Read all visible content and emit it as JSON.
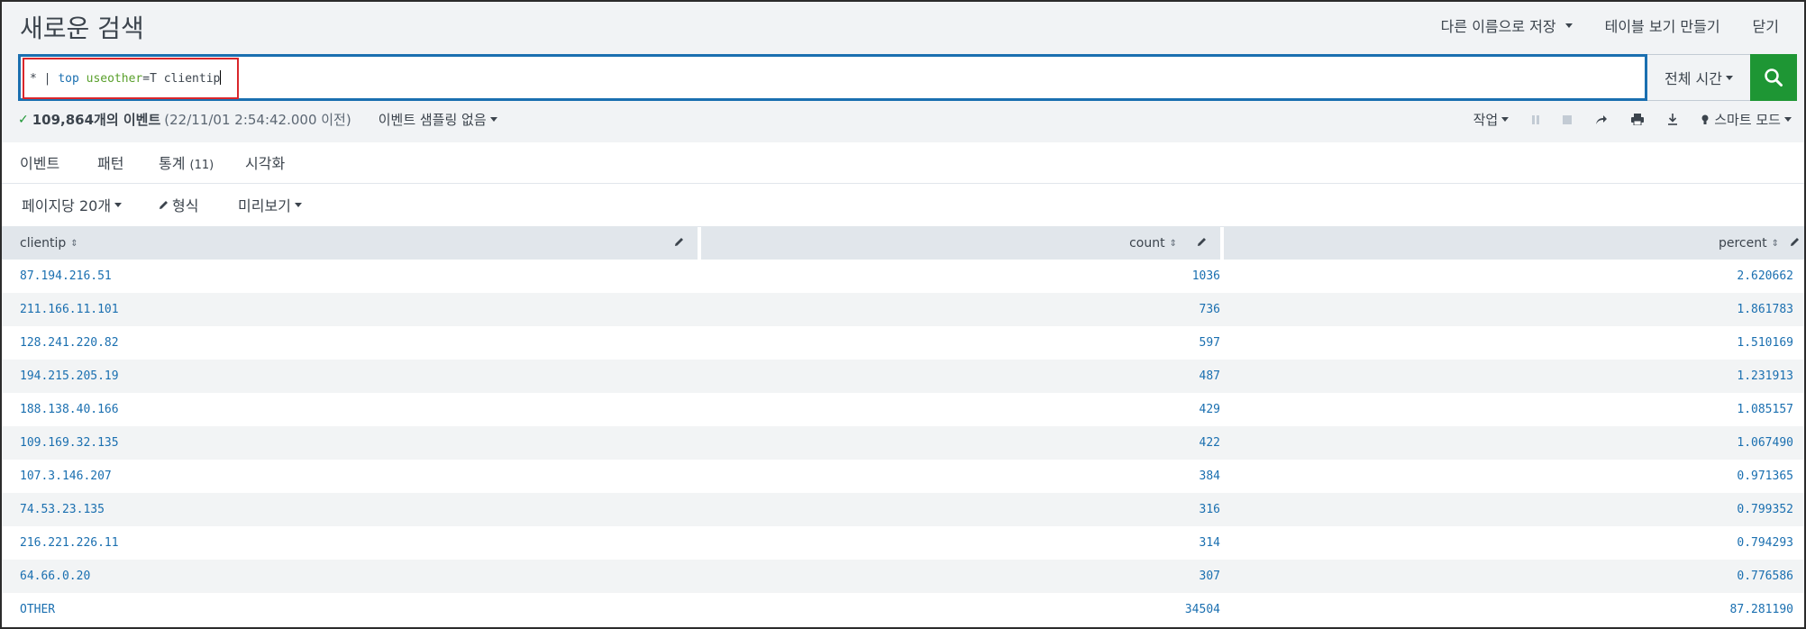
{
  "header": {
    "title": "새로운 검색",
    "save_as": "다른 이름으로 저장",
    "create_table_view": "테이블 보기 만들기",
    "close": "닫기"
  },
  "search": {
    "wildcard": "*",
    "pipe": "|",
    "command": "top",
    "arg_name": "useother",
    "arg_rest": "=T clientip",
    "time_range": "전체 시간"
  },
  "status": {
    "event_count": "109,864개의 이벤트",
    "event_time": "(22/11/01 2:54:42.000 이전)",
    "sampling": "이벤트 샘플링 없음",
    "job": "작업",
    "smart_mode": "스마트 모드"
  },
  "tabs": [
    {
      "label": "이벤트"
    },
    {
      "label": "패턴"
    },
    {
      "label": "통계",
      "count": "(11)"
    },
    {
      "label": "시각화"
    }
  ],
  "toolbar": {
    "per_page": "페이지당 20개",
    "format": "형식",
    "preview": "미리보기"
  },
  "table": {
    "columns": [
      "clientip",
      "count",
      "percent"
    ],
    "rows": [
      [
        "87.194.216.51",
        "1036",
        "2.620662"
      ],
      [
        "211.166.11.101",
        "736",
        "1.861783"
      ],
      [
        "128.241.220.82",
        "597",
        "1.510169"
      ],
      [
        "194.215.205.19",
        "487",
        "1.231913"
      ],
      [
        "188.138.40.166",
        "429",
        "1.085157"
      ],
      [
        "109.169.32.135",
        "422",
        "1.067490"
      ],
      [
        "107.3.146.207",
        "384",
        "0.971365"
      ],
      [
        "74.53.23.135",
        "316",
        "0.799352"
      ],
      [
        "216.221.226.11",
        "314",
        "0.794293"
      ],
      [
        "64.66.0.20",
        "307",
        "0.776586"
      ],
      [
        "OTHER",
        "34504",
        "87.281190"
      ]
    ]
  },
  "colors": {
    "accent": "#1a6fb0",
    "search_button": "#1e9634",
    "highlight_box": "#d9262b"
  }
}
